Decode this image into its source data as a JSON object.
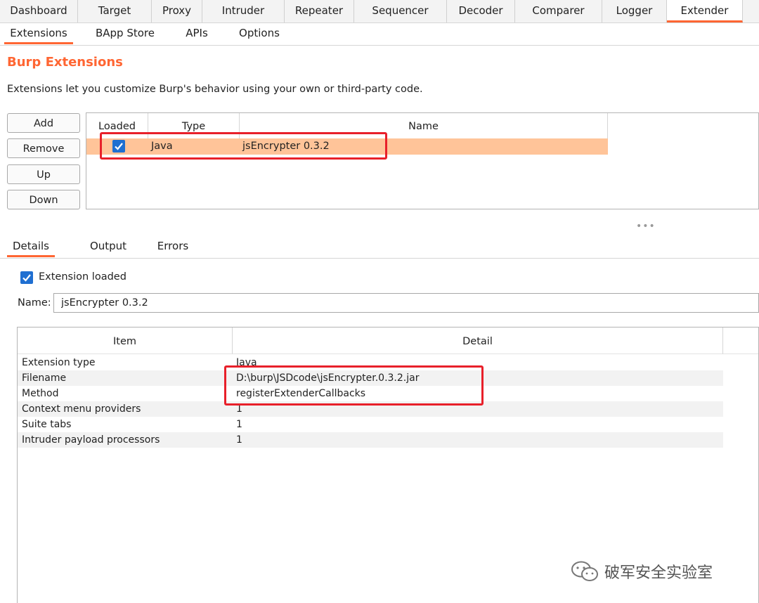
{
  "top_tabs": [
    "Dashboard",
    "Target",
    "Proxy",
    "Intruder",
    "Repeater",
    "Sequencer",
    "Decoder",
    "Comparer",
    "Logger",
    "Extender"
  ],
  "sub_tabs": [
    "Extensions",
    "BApp Store",
    "APIs",
    "Options"
  ],
  "page": {
    "title": "Burp Extensions",
    "description": "Extensions let you customize Burp's behavior using your own or third-party code."
  },
  "buttons": {
    "add": "Add",
    "remove": "Remove",
    "up": "Up",
    "down": "Down"
  },
  "extensions_table": {
    "columns": [
      "Loaded",
      "Type",
      "Name"
    ],
    "rows": [
      {
        "loaded": true,
        "type": "Java",
        "name": "jsEncrypter 0.3.2"
      }
    ]
  },
  "detail_tabs": [
    "Details",
    "Output",
    "Errors"
  ],
  "details": {
    "loaded_label": "Extension loaded",
    "name_label": "Name:",
    "name_value": "jsEncrypter 0.3.2",
    "columns": [
      "Item",
      "Detail"
    ],
    "rows": [
      {
        "item": "Extension type",
        "detail": "Java"
      },
      {
        "item": "Filename",
        "detail": "D:\\burp\\JSDcode\\jsEncrypter.0.3.2.jar"
      },
      {
        "item": "Method",
        "detail": "registerExtenderCallbacks"
      },
      {
        "item": "Context menu providers",
        "detail": "1"
      },
      {
        "item": "Suite tabs",
        "detail": "1"
      },
      {
        "item": "Intruder payload processors",
        "detail": "1"
      }
    ]
  },
  "watermark": {
    "text": "破军安全实验室"
  },
  "colors": {
    "accent": "#ff6633",
    "selected_row": "#ffc499",
    "annotation": "#e8202a",
    "checkbox": "#1f6fd1"
  }
}
